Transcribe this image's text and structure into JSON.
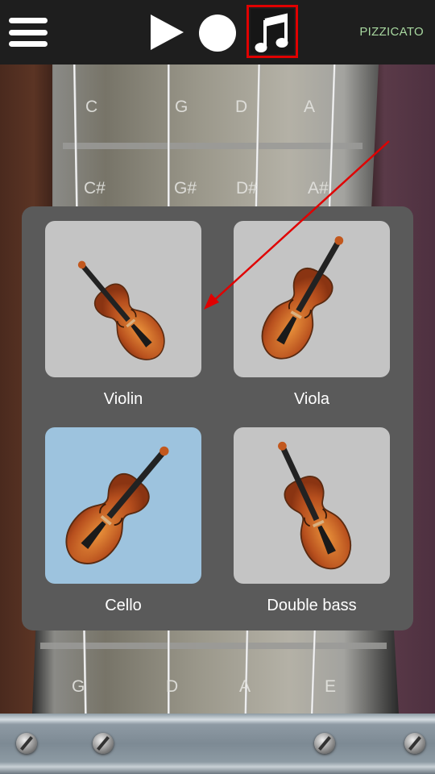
{
  "header": {
    "menu_icon": "hamburger-icon",
    "play_icon": "play-icon",
    "record_icon": "record-icon",
    "instrument_icon": "music-note-icon",
    "mode_label": "PIZZICATO"
  },
  "fingerboard": {
    "top_notes": [
      "C",
      "G",
      "D",
      "A"
    ],
    "second_notes": [
      "C#",
      "G#",
      "D#",
      "A#"
    ],
    "bottom_notes": [
      "G",
      "D",
      "A",
      "E"
    ]
  },
  "instrument_picker": {
    "selected": "Cello",
    "items": [
      {
        "label": "Violin"
      },
      {
        "label": "Viola"
      },
      {
        "label": "Cello"
      },
      {
        "label": "Double bass"
      }
    ]
  },
  "annotations": {
    "highlight_color": "#e00000",
    "arrow_color": "#e00000"
  },
  "colors": {
    "topbar": "#1e1e1e",
    "panel": "#5a5a5a",
    "tile": "#c4c4c4",
    "tile_selected": "#9dc3de",
    "mode_label": "#a8d8a0"
  }
}
